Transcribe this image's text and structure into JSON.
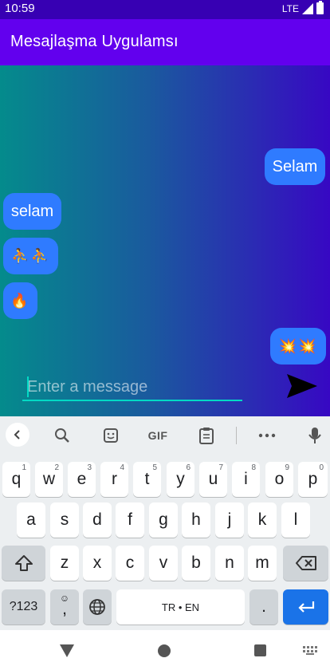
{
  "status_bar": {
    "time": "10:59",
    "network": "LTE"
  },
  "app_bar": {
    "title": "Mesajlaşma Uygulamsı"
  },
  "messages": [
    {
      "text": "Selam",
      "side": "right"
    },
    {
      "text": "selam",
      "side": "left"
    },
    {
      "text": "⛹⛹",
      "side": "left"
    },
    {
      "text": "🔥",
      "side": "left"
    },
    {
      "text": "💥💥",
      "side": "right"
    }
  ],
  "composer": {
    "placeholder": "Enter a message",
    "value": ""
  },
  "keyboard": {
    "toolbar": {
      "gif_label": "GIF"
    },
    "row1": [
      {
        "key": "q",
        "hint": "1"
      },
      {
        "key": "w",
        "hint": "2"
      },
      {
        "key": "e",
        "hint": "3"
      },
      {
        "key": "r",
        "hint": "4"
      },
      {
        "key": "t",
        "hint": "5"
      },
      {
        "key": "y",
        "hint": "6"
      },
      {
        "key": "u",
        "hint": "7"
      },
      {
        "key": "i",
        "hint": "8"
      },
      {
        "key": "o",
        "hint": "9"
      },
      {
        "key": "p",
        "hint": "0"
      }
    ],
    "row2": [
      "a",
      "s",
      "d",
      "f",
      "g",
      "h",
      "j",
      "k",
      "l"
    ],
    "row3": [
      "z",
      "x",
      "c",
      "v",
      "b",
      "n",
      "m"
    ],
    "symbols_label": "?123",
    "comma_label": ",",
    "space_label": "TR • EN",
    "period_label": "."
  },
  "colors": {
    "status": "#3700b3",
    "app_bar": "#6200ee",
    "bubble": "#2f7bff",
    "accent": "#03dac5",
    "enter": "#1a73e8"
  }
}
